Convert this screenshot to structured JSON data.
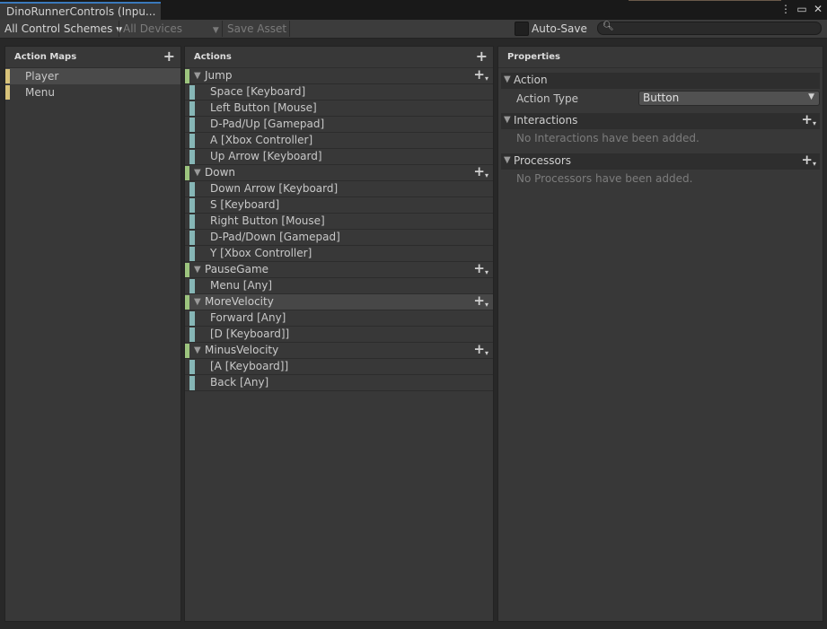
{
  "window": {
    "tab_title": "DinoRunnerControls (Inpu...",
    "menu_icon": "kebab-menu-icon",
    "maximize_icon": "maximize-icon",
    "close_icon": "close-icon"
  },
  "toolbar": {
    "control_schemes": "All Control Schemes",
    "devices": "All Devices",
    "save_asset": "Save Asset",
    "auto_save_label": "Auto-Save",
    "auto_save_checked": false,
    "search_placeholder": ""
  },
  "action_maps": {
    "title": "Action Maps",
    "items": [
      {
        "label": "Player",
        "selected": true
      },
      {
        "label": "Menu",
        "selected": false
      }
    ]
  },
  "actions": {
    "title": "Actions",
    "list": [
      {
        "type": "action",
        "label": "Jump"
      },
      {
        "type": "binding",
        "label": "Space [Keyboard]"
      },
      {
        "type": "binding",
        "label": "Left Button [Mouse]"
      },
      {
        "type": "binding",
        "label": "D-Pad/Up [Gamepad]"
      },
      {
        "type": "binding",
        "label": "A [Xbox Controller]"
      },
      {
        "type": "binding",
        "label": "Up Arrow [Keyboard]"
      },
      {
        "type": "action",
        "label": "Down"
      },
      {
        "type": "binding",
        "label": "Down Arrow [Keyboard]"
      },
      {
        "type": "binding",
        "label": "S [Keyboard]"
      },
      {
        "type": "binding",
        "label": "Right Button [Mouse]"
      },
      {
        "type": "binding",
        "label": "D-Pad/Down [Gamepad]"
      },
      {
        "type": "binding",
        "label": "Y [Xbox Controller]"
      },
      {
        "type": "action",
        "label": "PauseGame"
      },
      {
        "type": "binding",
        "label": "Menu [Any]"
      },
      {
        "type": "action",
        "label": "MoreVelocity",
        "selected": true
      },
      {
        "type": "binding",
        "label": "Forward [Any]"
      },
      {
        "type": "binding",
        "label": " [D [Keyboard]]"
      },
      {
        "type": "action",
        "label": "MinusVelocity"
      },
      {
        "type": "binding",
        "label": " [A [Keyboard]]"
      },
      {
        "type": "binding",
        "label": "Back [Any]"
      }
    ]
  },
  "properties": {
    "title": "Properties",
    "action_section": "Action",
    "action_type_label": "Action Type",
    "action_type_value": "Button",
    "interactions_section": "Interactions",
    "interactions_empty": "No Interactions have been added.",
    "processors_section": "Processors",
    "processors_empty": "No Processors have been added."
  },
  "colors": {
    "action_map_accent": "#d8c37a",
    "action_accent": "#9cc47e",
    "binding_accent": "#86b6b6",
    "tab_highlight": "#3a79bb"
  }
}
